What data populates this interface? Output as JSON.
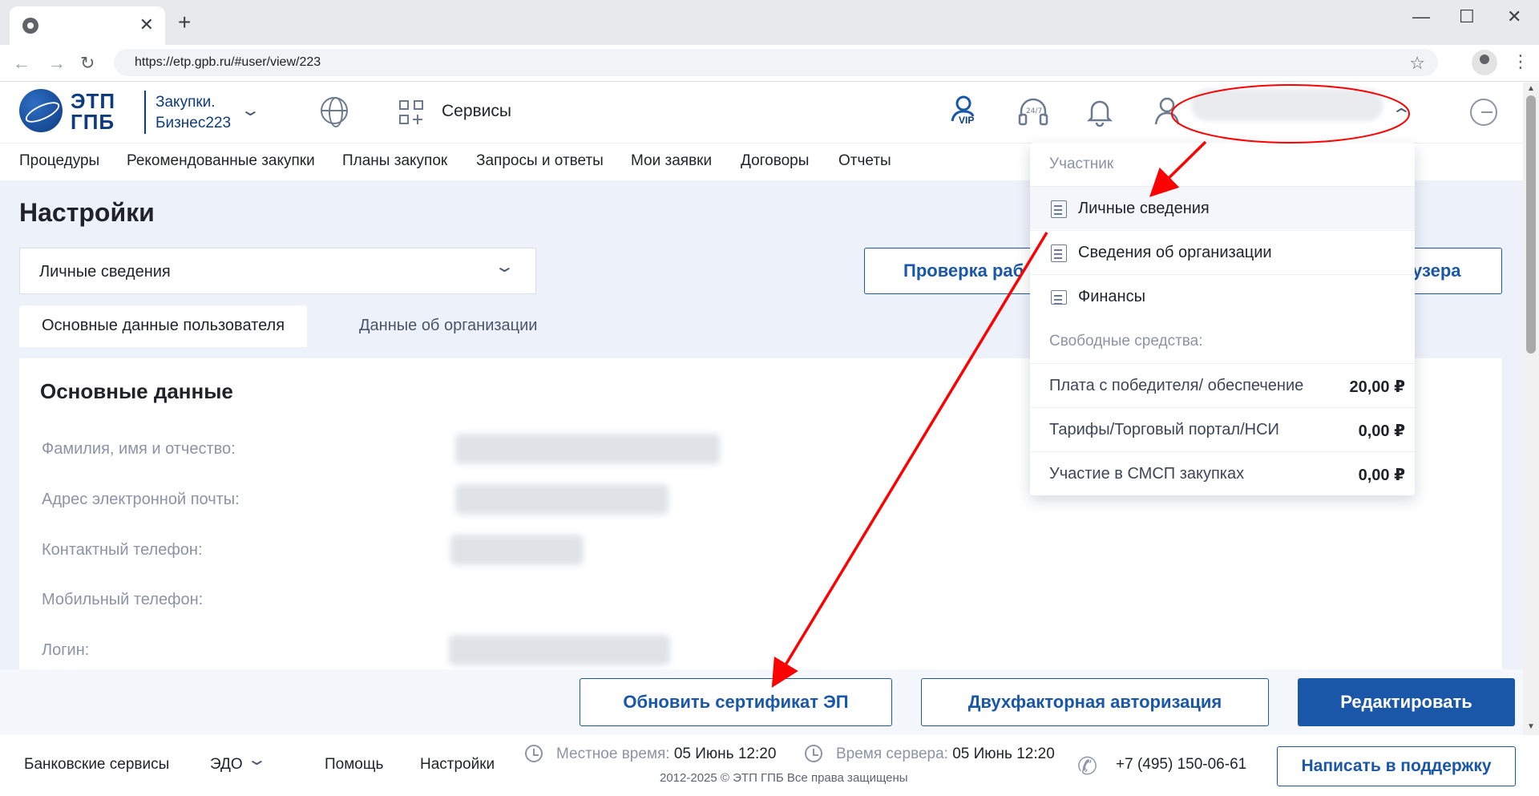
{
  "browser": {
    "url": "https://etp.gpb.ru/#user/view/223"
  },
  "header": {
    "logo_text": "ЭТП ГПБ",
    "product_line1": "Закупки.",
    "product_line2": "Бизнес223",
    "services_label": "Сервисы",
    "vip_label": "VIP",
    "support_badge": "24/7"
  },
  "nav": [
    "Процедуры",
    "Рекомендованные закупки",
    "Планы закупок",
    "Запросы и ответы",
    "Мои заявки",
    "Договоры",
    "Отчеты"
  ],
  "page": {
    "title": "Настройки",
    "settings_select_value": "Личные сведения",
    "check_button_visible": "Проверка раб",
    "right_button_visible": "узера",
    "tabs": [
      "Основные данные пользователя",
      "Данные об организации"
    ],
    "card_title": "Основные данные",
    "fields": [
      "Фамилия, имя и отчество:",
      "Адрес электронной почты:",
      "Контактный телефон:",
      "Мобильный телефон:",
      "Логин:"
    ]
  },
  "actions": {
    "update_cert": "Обновить сертификат ЭП",
    "two_factor": "Двухфакторная авторизация",
    "edit": "Редактировать"
  },
  "footer": {
    "bank_services": "Банковские сервисы",
    "edo": "ЭДО",
    "help": "Помощь",
    "settings": "Настройки",
    "local_time_label": "Местное время:",
    "local_time_value": "05 Июнь 12:20",
    "server_time_label": "Время сервера:",
    "server_time_value": "05 Июнь 12:20",
    "copyright": "2012-2025 © ЭТП ГПБ Все права защищены",
    "phone": "+7 (495) 150-06-61",
    "support_button": "Написать в поддержку"
  },
  "dropdown": {
    "section_participant": "Участник",
    "items": [
      "Личные сведения",
      "Сведения об организации",
      "Финансы"
    ],
    "section_funds": "Свободные средства:",
    "balances": [
      {
        "label": "Плата с победителя/ обеспечение",
        "value": "20,00 ₽"
      },
      {
        "label": "Тарифы/Торговый портал/НСИ",
        "value": "0,00 ₽"
      },
      {
        "label": "Участие в СМСП закупках",
        "value": "0,00 ₽"
      }
    ]
  },
  "colors": {
    "brand_blue": "#1b57a8",
    "content_bg": "#edf2fa",
    "annotation_red": "#ff0000"
  }
}
